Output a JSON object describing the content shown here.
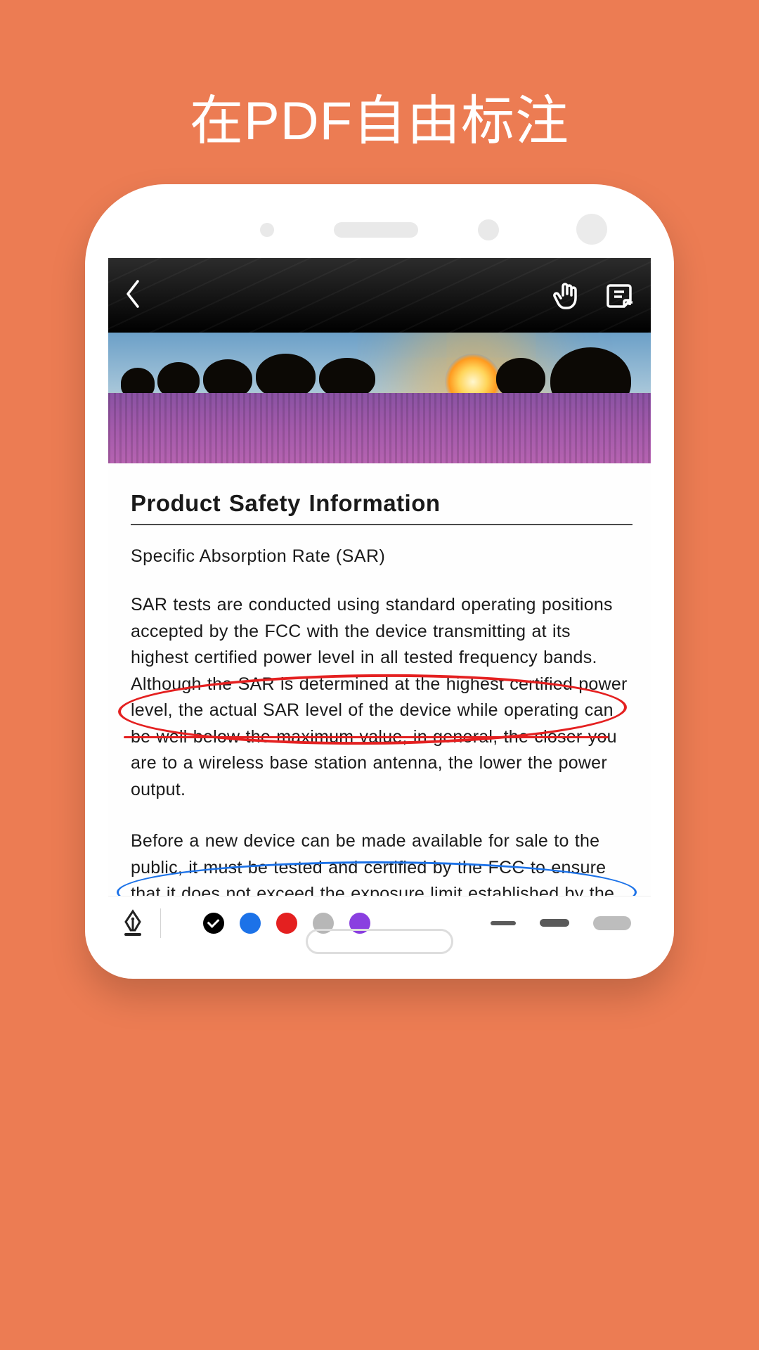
{
  "headline": "在PDF自由标注",
  "doc": {
    "title": "Product Safety Information",
    "subtitle": "Specific Absorption Rate (SAR)",
    "para1": "SAR tests are conducted using standard operating positions accepted by the FCC with the device transmitting at its highest certified power level in all tested frequency bands. Although the SAR is determined at the highest certified power level, the actual SAR level of the device while operating can be well below the maximum value, in general, the closer you are to a wireless base station antenna, the lower the power output.",
    "para2": "Before a new device can be made available for sale to the public, it must be tested and certified by the FCC to ensure that it does not exceed the exposure limit established by the FCC. Tests for each device are performed in positions and locations as required by the FCC."
  },
  "annotations": {
    "red_ellipse": "certified power level in all tested frequency bands. Although the SAR is determined at",
    "red_strike": "the highest certified power level, the actual",
    "blue_ellipse": "for sale to the public, it must be tested and certified by the FCC to ensure that it does not"
  },
  "toolbar": {
    "colors": [
      "black",
      "blue",
      "red",
      "gray",
      "purple"
    ],
    "selected_color": "black",
    "stroke_widths": [
      "thin",
      "medium",
      "thick"
    ],
    "selected_stroke": "thin"
  },
  "icons": {
    "back": "chevron-left",
    "hand": "hand-pointer",
    "add_note": "note-add",
    "pen": "fountain-pen"
  }
}
